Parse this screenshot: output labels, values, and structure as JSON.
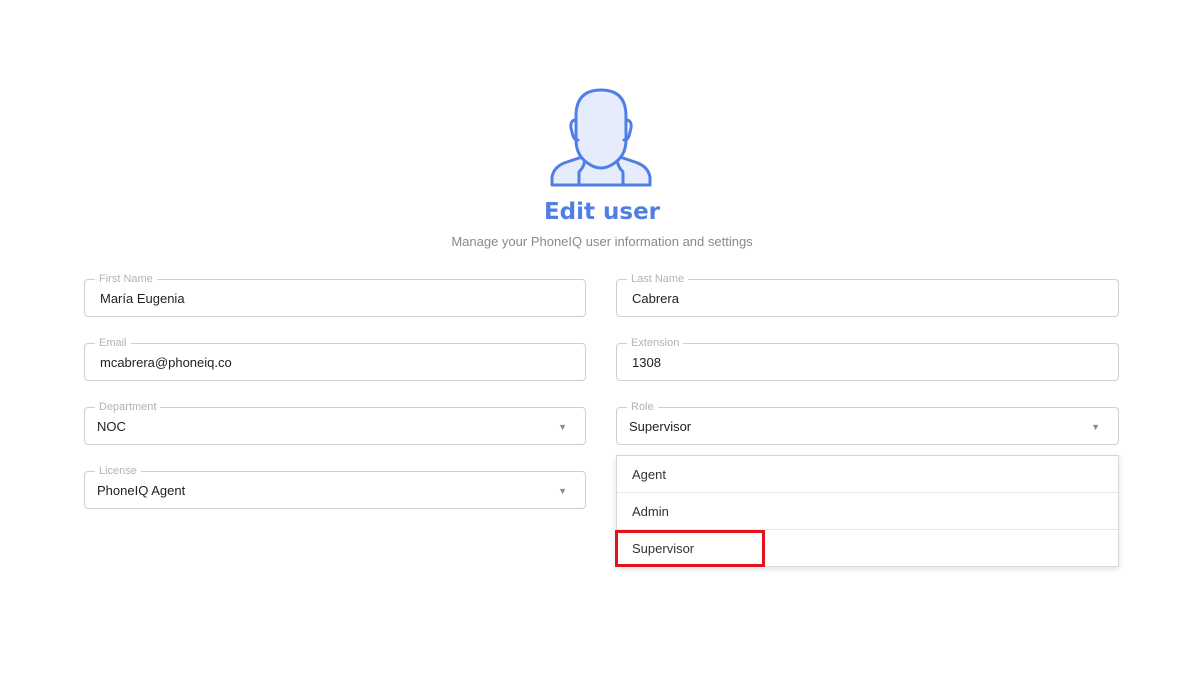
{
  "header": {
    "title": "Edit user",
    "subtitle": "Manage your PhoneIQ user information and settings",
    "avatar_icon": "user-avatar-icon",
    "accent_color": "#4f7fe6"
  },
  "form": {
    "first_name": {
      "label": "First Name",
      "value": "María Eugenia"
    },
    "last_name": {
      "label": "Last Name",
      "value": "Cabrera"
    },
    "email": {
      "label": "Email",
      "value": "mcabrera@phoneiq.co"
    },
    "extension": {
      "label": "Extension",
      "value": "1308"
    },
    "department": {
      "label": "Department",
      "value": "NOC",
      "icon": "chevron-down-icon"
    },
    "role": {
      "label": "Role",
      "value": "Supervisor",
      "icon": "chevron-down-icon"
    },
    "license": {
      "label": "License",
      "value": "PhoneIQ Agent",
      "icon": "chevron-down-icon"
    }
  },
  "role_dropdown": {
    "options": [
      "Agent",
      "Admin",
      "Supervisor"
    ],
    "highlighted": "Supervisor",
    "highlight_color": "#e0151c"
  }
}
